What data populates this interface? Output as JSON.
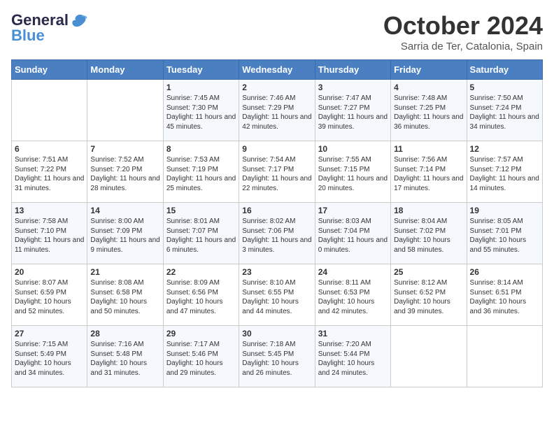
{
  "header": {
    "logo_general": "General",
    "logo_blue": "Blue",
    "month": "October 2024",
    "location": "Sarria de Ter, Catalonia, Spain"
  },
  "days_of_week": [
    "Sunday",
    "Monday",
    "Tuesday",
    "Wednesday",
    "Thursday",
    "Friday",
    "Saturday"
  ],
  "weeks": [
    [
      {
        "num": "",
        "content": ""
      },
      {
        "num": "",
        "content": ""
      },
      {
        "num": "1",
        "content": "Sunrise: 7:45 AM\nSunset: 7:30 PM\nDaylight: 11 hours and 45 minutes."
      },
      {
        "num": "2",
        "content": "Sunrise: 7:46 AM\nSunset: 7:29 PM\nDaylight: 11 hours and 42 minutes."
      },
      {
        "num": "3",
        "content": "Sunrise: 7:47 AM\nSunset: 7:27 PM\nDaylight: 11 hours and 39 minutes."
      },
      {
        "num": "4",
        "content": "Sunrise: 7:48 AM\nSunset: 7:25 PM\nDaylight: 11 hours and 36 minutes."
      },
      {
        "num": "5",
        "content": "Sunrise: 7:50 AM\nSunset: 7:24 PM\nDaylight: 11 hours and 34 minutes."
      }
    ],
    [
      {
        "num": "6",
        "content": "Sunrise: 7:51 AM\nSunset: 7:22 PM\nDaylight: 11 hours and 31 minutes."
      },
      {
        "num": "7",
        "content": "Sunrise: 7:52 AM\nSunset: 7:20 PM\nDaylight: 11 hours and 28 minutes."
      },
      {
        "num": "8",
        "content": "Sunrise: 7:53 AM\nSunset: 7:19 PM\nDaylight: 11 hours and 25 minutes."
      },
      {
        "num": "9",
        "content": "Sunrise: 7:54 AM\nSunset: 7:17 PM\nDaylight: 11 hours and 22 minutes."
      },
      {
        "num": "10",
        "content": "Sunrise: 7:55 AM\nSunset: 7:15 PM\nDaylight: 11 hours and 20 minutes."
      },
      {
        "num": "11",
        "content": "Sunrise: 7:56 AM\nSunset: 7:14 PM\nDaylight: 11 hours and 17 minutes."
      },
      {
        "num": "12",
        "content": "Sunrise: 7:57 AM\nSunset: 7:12 PM\nDaylight: 11 hours and 14 minutes."
      }
    ],
    [
      {
        "num": "13",
        "content": "Sunrise: 7:58 AM\nSunset: 7:10 PM\nDaylight: 11 hours and 11 minutes."
      },
      {
        "num": "14",
        "content": "Sunrise: 8:00 AM\nSunset: 7:09 PM\nDaylight: 11 hours and 9 minutes."
      },
      {
        "num": "15",
        "content": "Sunrise: 8:01 AM\nSunset: 7:07 PM\nDaylight: 11 hours and 6 minutes."
      },
      {
        "num": "16",
        "content": "Sunrise: 8:02 AM\nSunset: 7:06 PM\nDaylight: 11 hours and 3 minutes."
      },
      {
        "num": "17",
        "content": "Sunrise: 8:03 AM\nSunset: 7:04 PM\nDaylight: 11 hours and 0 minutes."
      },
      {
        "num": "18",
        "content": "Sunrise: 8:04 AM\nSunset: 7:02 PM\nDaylight: 10 hours and 58 minutes."
      },
      {
        "num": "19",
        "content": "Sunrise: 8:05 AM\nSunset: 7:01 PM\nDaylight: 10 hours and 55 minutes."
      }
    ],
    [
      {
        "num": "20",
        "content": "Sunrise: 8:07 AM\nSunset: 6:59 PM\nDaylight: 10 hours and 52 minutes."
      },
      {
        "num": "21",
        "content": "Sunrise: 8:08 AM\nSunset: 6:58 PM\nDaylight: 10 hours and 50 minutes."
      },
      {
        "num": "22",
        "content": "Sunrise: 8:09 AM\nSunset: 6:56 PM\nDaylight: 10 hours and 47 minutes."
      },
      {
        "num": "23",
        "content": "Sunrise: 8:10 AM\nSunset: 6:55 PM\nDaylight: 10 hours and 44 minutes."
      },
      {
        "num": "24",
        "content": "Sunrise: 8:11 AM\nSunset: 6:53 PM\nDaylight: 10 hours and 42 minutes."
      },
      {
        "num": "25",
        "content": "Sunrise: 8:12 AM\nSunset: 6:52 PM\nDaylight: 10 hours and 39 minutes."
      },
      {
        "num": "26",
        "content": "Sunrise: 8:14 AM\nSunset: 6:51 PM\nDaylight: 10 hours and 36 minutes."
      }
    ],
    [
      {
        "num": "27",
        "content": "Sunrise: 7:15 AM\nSunset: 5:49 PM\nDaylight: 10 hours and 34 minutes."
      },
      {
        "num": "28",
        "content": "Sunrise: 7:16 AM\nSunset: 5:48 PM\nDaylight: 10 hours and 31 minutes."
      },
      {
        "num": "29",
        "content": "Sunrise: 7:17 AM\nSunset: 5:46 PM\nDaylight: 10 hours and 29 minutes."
      },
      {
        "num": "30",
        "content": "Sunrise: 7:18 AM\nSunset: 5:45 PM\nDaylight: 10 hours and 26 minutes."
      },
      {
        "num": "31",
        "content": "Sunrise: 7:20 AM\nSunset: 5:44 PM\nDaylight: 10 hours and 24 minutes."
      },
      {
        "num": "",
        "content": ""
      },
      {
        "num": "",
        "content": ""
      }
    ]
  ]
}
